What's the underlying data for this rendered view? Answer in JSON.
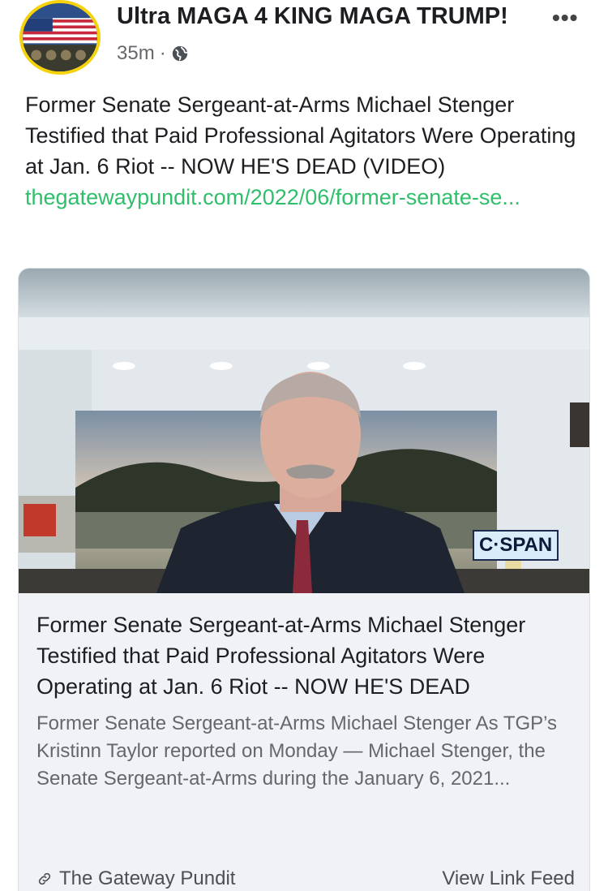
{
  "post": {
    "author": "Ultra MAGA 4 KING MAGA TRUMP!",
    "time": "35m",
    "separator": "·",
    "privacy_icon": "globe-icon",
    "more_icon": "•••",
    "text": "Former Senate Sergeant-at-Arms Michael Stenger Testified that Paid Professional Agitators Were Operating at Jan. 6 Riot -- NOW HE'S DEAD (VIDEO)",
    "link_text": "thegatewaypundit.com/2022/06/former-senate-se..."
  },
  "card": {
    "watermark": "C·SPAN",
    "title": "Former Senate Sergeant-at-Arms Michael Stenger Testified that Paid Professional Agitators Were Operating at Jan. 6 Riot -- NOW HE'S DEAD",
    "description": "Former Senate Sergeant-at-Arms Michael Stenger As TGP’s Kristinn Taylor reported on Monday — Michael Stenger, the Senate Sergeant-at-Arms during the January 6, 2021...",
    "source": "The Gateway Pundit",
    "source_icon": "link-icon",
    "action": "View Link Feed"
  },
  "colors": {
    "link": "#2fbf6a",
    "avatar_border": "#f5d20a",
    "card_bg": "#f0f2f5"
  }
}
